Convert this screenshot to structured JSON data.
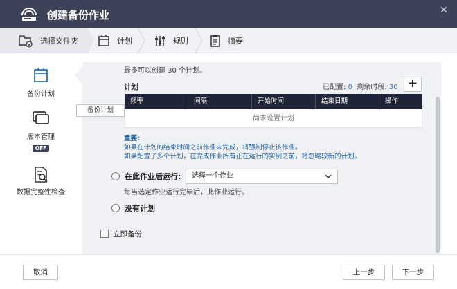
{
  "window": {
    "title": "创建备份作业",
    "close_glyph": "✕"
  },
  "steps": [
    {
      "label": "选择文件夹",
      "icon": "folder-check-icon"
    },
    {
      "label": "计划",
      "icon": "calendar-icon"
    },
    {
      "label": "规则",
      "icon": "sliders-icon"
    },
    {
      "label": "摘要",
      "icon": "clipboard-icon"
    }
  ],
  "sidebar": {
    "items": [
      {
        "label": "备份计划",
        "icon": "calendar-icon"
      },
      {
        "label": "版本管理",
        "icon": "versions-icon",
        "badge": "OFF"
      },
      {
        "label": "数据完整性检查",
        "icon": "document-search-icon"
      }
    ],
    "tooltip": "备份计划"
  },
  "schedule": {
    "limit_text": "最多可以创建 30 个计划。",
    "title": "计划",
    "configured_label": "已配置:",
    "configured_value": "0",
    "remaining_label": "剩余时段:",
    "remaining_value": "30",
    "add_glyph": "+",
    "columns": [
      "频率",
      "间隔",
      "开始时间",
      "结束日期",
      "操作"
    ],
    "empty_text": "尚未设置计划",
    "important_title": "重要:",
    "important_lines": [
      "如果在计划的结束时间之前作业未完成，将强制停止该作业。",
      "如果配置了多个计划，在完成作业所有正在运行的实例之前，将忽略较新的计划。"
    ]
  },
  "options": {
    "run_after_label": "在此作业后运行:",
    "run_after_select": "选择一个作业",
    "run_after_hint": "每当选定作业运行完毕后，此作业运行。",
    "no_schedule_label": "没有计划",
    "backup_now_label": "立即备份"
  },
  "footer": {
    "cancel": "取消",
    "prev": "上一步",
    "next": "下一步"
  },
  "colors": {
    "titlebar": "#3e4258",
    "accent_blue": "#2b74c2",
    "table_header": "#1f2436"
  }
}
